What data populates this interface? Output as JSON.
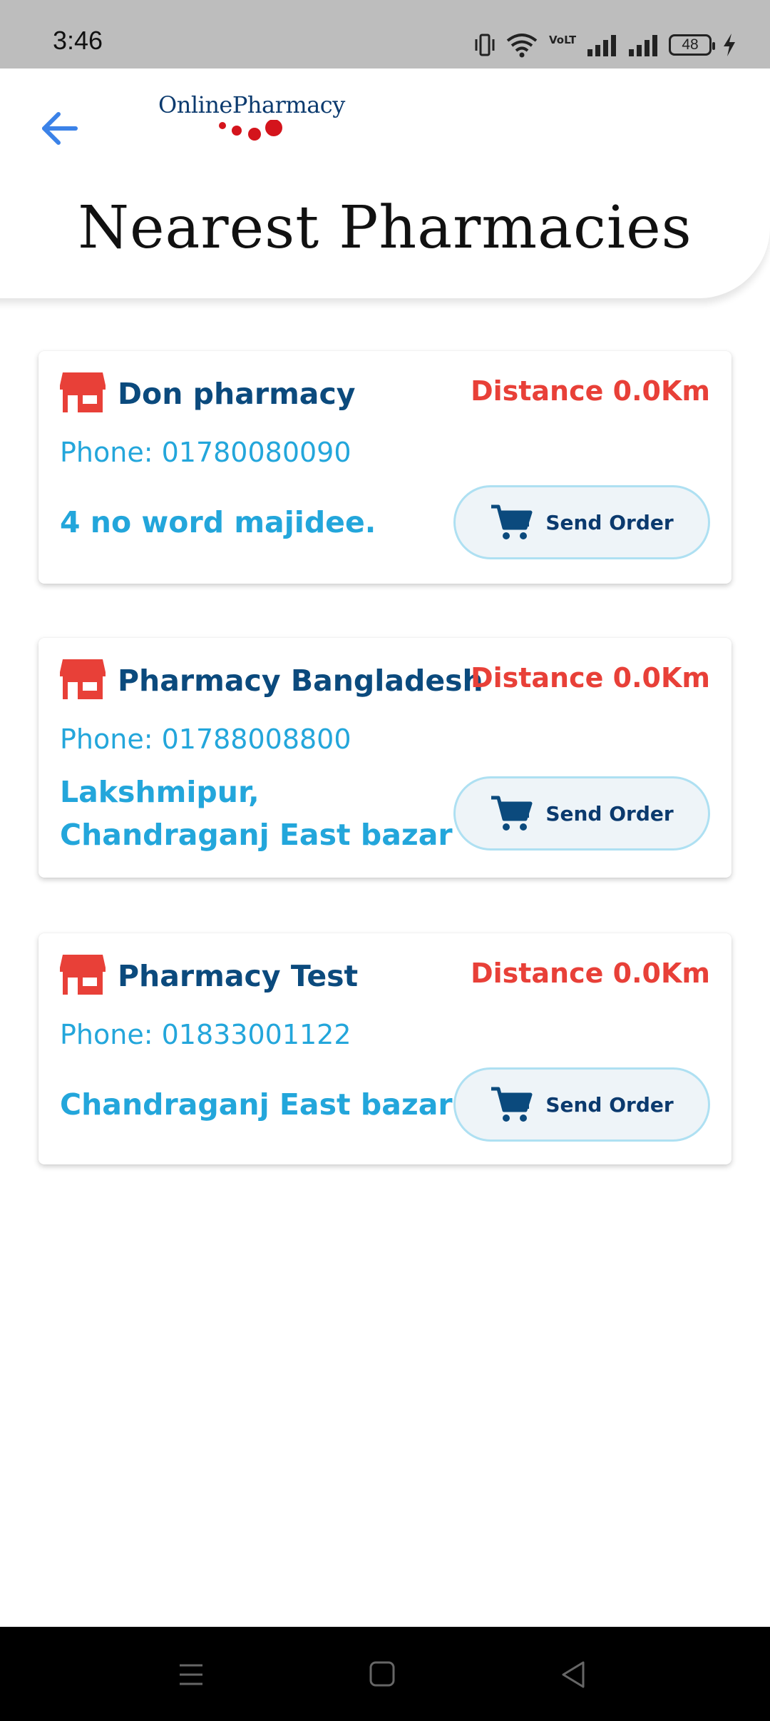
{
  "status_bar": {
    "time": "3:46",
    "network_label": "VoLTE2",
    "battery": "48",
    "icons": [
      "vibrate-icon",
      "wifi-icon",
      "volte-icon",
      "signal-icon",
      "signal-icon",
      "battery-icon",
      "charging-icon"
    ]
  },
  "header": {
    "logo_text": "OnlinePharmacy",
    "title": "Nearest Pharmacies",
    "back_icon": "arrow-left-icon"
  },
  "pharmacies": [
    {
      "name": "Don pharmacy",
      "distance": "Distance 0.0Km",
      "phone": "Phone: 01780080090",
      "address": "4 no word majidee.",
      "button": "Send Order"
    },
    {
      "name": "Pharmacy Bangladesh",
      "distance": "Distance 0.0Km",
      "phone": "Phone: 01788008800",
      "address": "Lakshmipur, Chandraganj East bazar",
      "button": "Send Order"
    },
    {
      "name": "Pharmacy Test",
      "distance": "Distance 0.0Km",
      "phone": "Phone: 01833001122",
      "address": "Chandraganj East bazar",
      "button": "Send Order"
    }
  ],
  "colors": {
    "accent_red": "#e84038",
    "name_blue": "#0b4a7d",
    "link_blue": "#23a6db",
    "back_arrow": "#3b82e8"
  },
  "nav_bar": {
    "icons": [
      "menu-icon",
      "home-icon",
      "back-icon"
    ]
  }
}
